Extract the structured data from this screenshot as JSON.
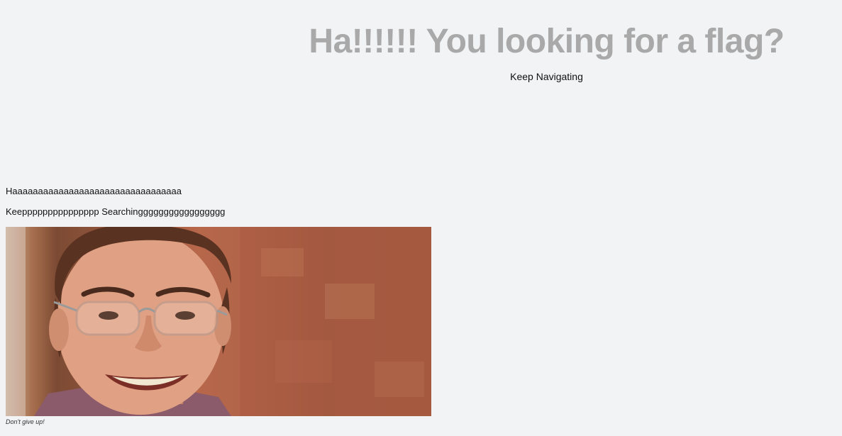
{
  "hero": {
    "title": "Ha!!!!!! You looking for a flag?",
    "subtitle": "Keep Navigating"
  },
  "body_lines": [
    "Haaaaaaaaaaaaaaaaaaaaaaaaaaaaaaaaa",
    "Keeppppppppppppppp Searchinggggggggggggggggg"
  ],
  "image": {
    "semantic": "smiling-man-with-glasses-photo",
    "caption": "Don't give up!"
  },
  "colors": {
    "background": "#f2f3f5",
    "title": "#a9a9a9",
    "text": "#111111"
  }
}
